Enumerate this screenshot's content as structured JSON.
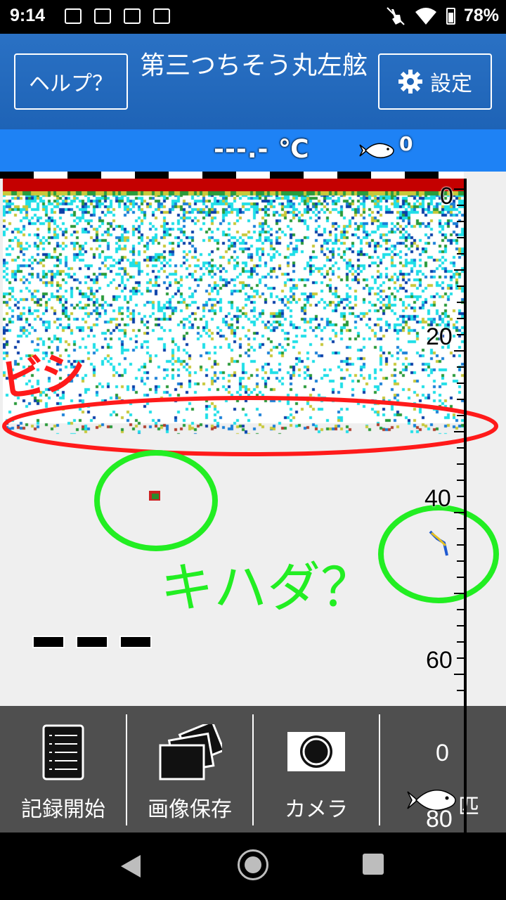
{
  "status_bar": {
    "time": "9:14",
    "battery": "78%"
  },
  "header": {
    "help_label": "ヘルプ？",
    "title": "第三つちそう丸左舷",
    "settings_label": "設定"
  },
  "info_bar": {
    "temperature": "---.- ℃",
    "fish_count": "0"
  },
  "depth_scale": {
    "labels": [
      "0",
      "20",
      "40",
      "60",
      "80"
    ]
  },
  "annotations": {
    "red_text": "ビシ",
    "green_text": "キハダ？"
  },
  "toolbar": {
    "record_label": "記録開始",
    "save_image_label": "画像保存",
    "camera_label": "カメラ",
    "fish_counter_value": "0",
    "fish_unit": "匹"
  },
  "colors": {
    "header_blue": "#1e63b6",
    "info_blue": "#1e82f5",
    "red_ellipse": "#ff1a1a",
    "green_circle": "#22ee22"
  }
}
